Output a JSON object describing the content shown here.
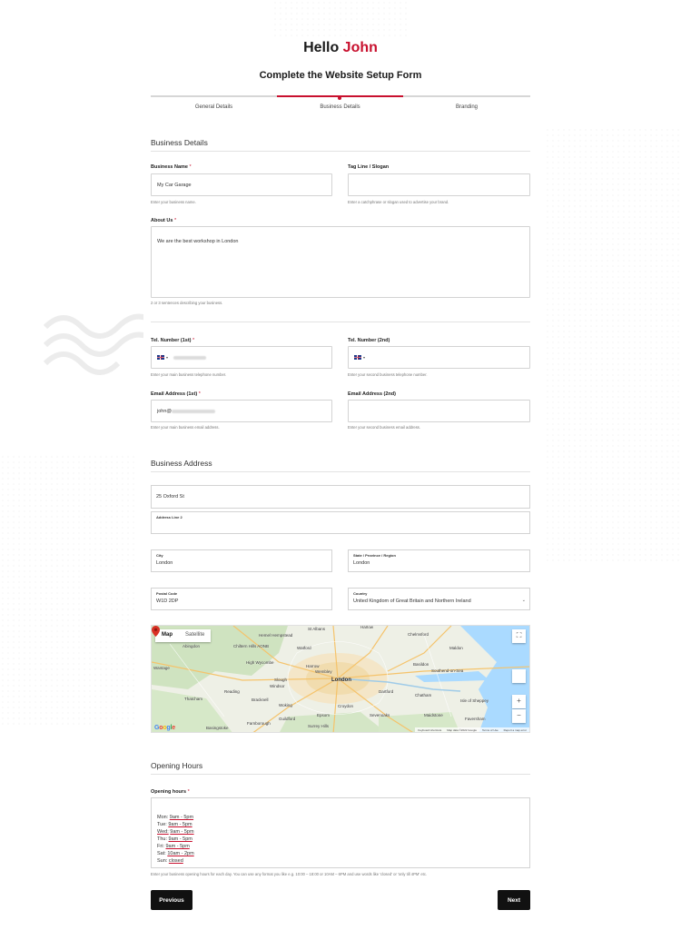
{
  "header": {
    "greeting": "Hello",
    "user_name": "John",
    "form_title": "Complete the Website Setup Form"
  },
  "steps": [
    {
      "label": "General Details",
      "active": false
    },
    {
      "label": "Business Details",
      "active": true
    },
    {
      "label": "Branding",
      "active": false
    }
  ],
  "business_details": {
    "section_title": "Business Details",
    "business_name": {
      "label": "Business Name",
      "required": "*",
      "value": "My Car Garage",
      "hint": "Enter your business name."
    },
    "tagline": {
      "label": "Tag Line / Slogan",
      "value": "",
      "hint": "Enter a catchphrase or slogan used to advertise your brand."
    },
    "about": {
      "label": "About Us",
      "required": "*",
      "value": "We are the best workshop in London",
      "hint": "2 or 3 sentences describing your business."
    },
    "tel1": {
      "label": "Tel. Number (1st)",
      "required": "*",
      "hint": "Enter your main business telephone number."
    },
    "tel2": {
      "label": "Tel. Number (2nd)",
      "hint": "Enter your second business telephone number."
    },
    "email1": {
      "label": "Email Address (1st)",
      "required": "*",
      "value": "john@",
      "hint": "Enter your main business email address."
    },
    "email2": {
      "label": "Email Address (2nd)",
      "hint": "Enter your second business email address."
    }
  },
  "business_address": {
    "section_title": "Business Address",
    "line1": "25 Oxford St",
    "line2_label": "Address Line 2",
    "city": {
      "label": "City",
      "value": "London"
    },
    "state": {
      "label": "State / Province / Region",
      "value": "London"
    },
    "postal": {
      "label": "Postal Code",
      "value": "W1D 2DP"
    },
    "country": {
      "label": "Country",
      "value": "United Kingdom of Great Britain and Northern Ireland"
    }
  },
  "map": {
    "tab_map": "Map",
    "tab_satellite": "Satellite",
    "zoom_in": "+",
    "zoom_out": "−",
    "fullscreen": "⛶",
    "labels": {
      "london": "London",
      "st_albans": "St Albans",
      "harlow": "Harlow",
      "chelmsford": "Chelmsford",
      "maldon": "Maldon",
      "watford": "Watford",
      "hemel": "Hemel Hempstead",
      "chiltern": "Chiltern Hills AONB",
      "high_wycombe": "High Wycombe",
      "harrow": "Harrow",
      "wembley": "Wembley",
      "slough": "Slough",
      "windsor": "Windsor",
      "reading": "Reading",
      "bracknell": "Bracknell",
      "woking": "Woking",
      "guildford": "Guildford",
      "croydon": "Croydon",
      "epsom": "Epsom",
      "dartford": "Dartford",
      "basildon": "Basildon",
      "southend": "Southend-on-Sea",
      "chatham": "Chatham",
      "maidstone": "Maidstone",
      "sevenoaks": "Sevenoaks",
      "faversham": "Faversham",
      "sheppey": "Isle of Sheppey",
      "thatcham": "Thatcham",
      "farnborough": "Farnborough",
      "aylesbury": "Abingdon",
      "wantage": "Wantage",
      "basingstoke": "Basingstoke",
      "surrey_hills": "Surrey Hills"
    },
    "footer": [
      "Keyboard shortcuts",
      "Map data ©2022 Google",
      "Terms of Use",
      "Report a map error"
    ],
    "logo": "Google"
  },
  "opening_hours": {
    "section_title": "Opening Hours",
    "label": "Opening hours",
    "required": "*",
    "lines": [
      {
        "day": "Mon:",
        "time": "9am - 5pm"
      },
      {
        "day": "Tue:",
        "time": "9am - 5pm"
      },
      {
        "day": "Wed:",
        "time": "9am - 5pm"
      },
      {
        "day": "Thu:",
        "time": "9am - 5pm"
      },
      {
        "day": "Fri:",
        "time": "9am - 5pm"
      },
      {
        "day": "Sat:",
        "time": "10am - 2pm"
      },
      {
        "day": "Sun:",
        "time": "closed"
      }
    ],
    "hint": "Enter your business opening hours for each day. You can use any format you like e.g. 10:00 – 18:00 or 10AM – 6PM and use words like 'closed' or 'only till 4PM' etc."
  },
  "nav": {
    "previous": "Previous",
    "next": "Next"
  },
  "colors": {
    "accent": "#c8102e",
    "button": "#111111"
  }
}
